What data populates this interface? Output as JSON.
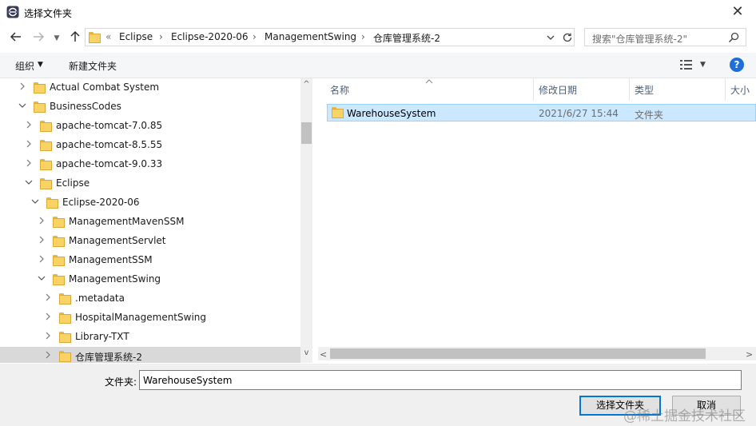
{
  "window": {
    "title": "选择文件夹"
  },
  "nav": {
    "breadcrumbs": [
      "Eclipse",
      "Eclipse-2020-06",
      "ManagementSwing",
      "仓库管理系统-2"
    ],
    "overflow": "«",
    "search_placeholder": "搜索\"仓库管理系统-2\""
  },
  "toolbar": {
    "organize": "组织",
    "new_folder": "新建文件夹"
  },
  "tree": [
    {
      "label": "Actual Combat System",
      "expanded": false,
      "selected": false
    },
    {
      "label": "BusinessCodes",
      "expanded": true,
      "selected": false
    },
    {
      "label": "apache-tomcat-7.0.85",
      "expanded": false,
      "selected": false
    },
    {
      "label": "apache-tomcat-8.5.55",
      "expanded": false,
      "selected": false
    },
    {
      "label": "apache-tomcat-9.0.33",
      "expanded": false,
      "selected": false
    },
    {
      "label": "Eclipse",
      "expanded": true,
      "selected": false
    },
    {
      "label": "Eclipse-2020-06",
      "expanded": true,
      "selected": false
    },
    {
      "label": "ManagementMavenSSM",
      "expanded": false,
      "selected": false
    },
    {
      "label": "ManagementServlet",
      "expanded": false,
      "selected": false
    },
    {
      "label": "ManagementSSM",
      "expanded": false,
      "selected": false
    },
    {
      "label": "ManagementSwing",
      "expanded": true,
      "selected": false
    },
    {
      "label": ".metadata",
      "expanded": false,
      "selected": false
    },
    {
      "label": "HospitalManagementSwing",
      "expanded": false,
      "selected": false
    },
    {
      "label": "Library-TXT",
      "expanded": false,
      "selected": false
    },
    {
      "label": "仓库管理系统-2",
      "expanded": false,
      "selected": true
    }
  ],
  "list": {
    "columns": {
      "name": "名称",
      "modified": "修改日期",
      "type": "类型",
      "size": "大小"
    },
    "rows": [
      {
        "name": "WarehouseSystem",
        "modified": "2021/6/27 15:44",
        "type": "文件夹"
      }
    ]
  },
  "footer": {
    "folder_label": "文件夹:",
    "folder_value": "WarehouseSystem",
    "select_button": "选择文件夹",
    "cancel_button": "取消"
  },
  "watermark": "@稀土掘金技术社区"
}
